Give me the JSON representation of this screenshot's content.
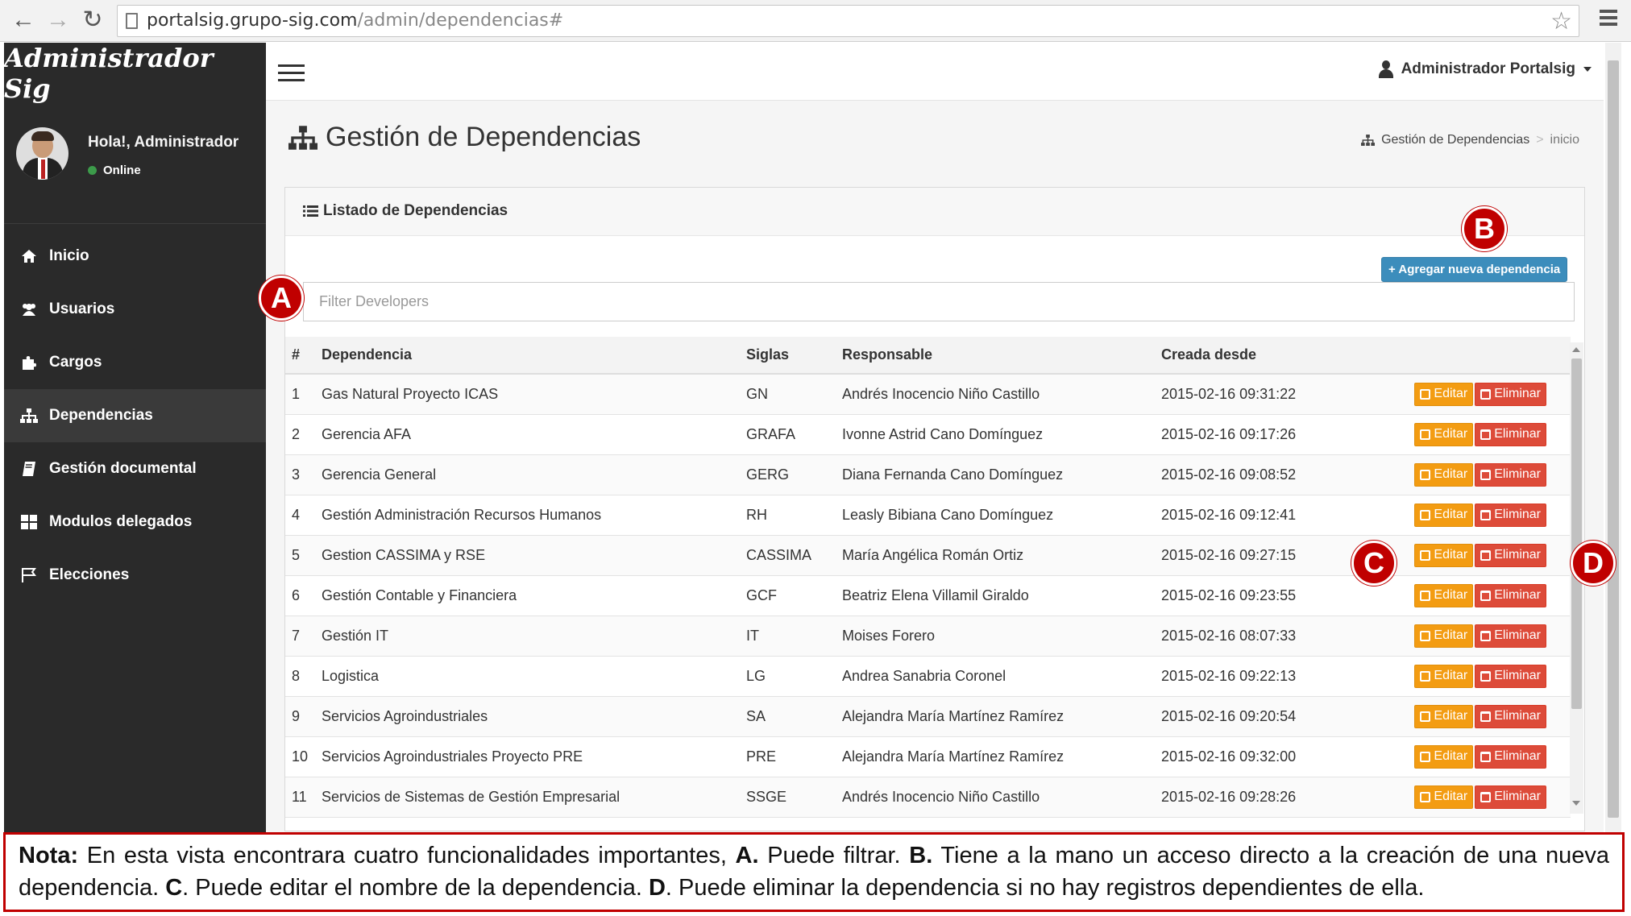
{
  "browser": {
    "url_host": "portalsig.grupo-sig.com",
    "url_path": "/admin/dependencias#"
  },
  "sidebar": {
    "brand": "Administrador Sig",
    "greeting": "Hola!, Administrador",
    "status": "Online",
    "items": [
      {
        "label": "Inicio",
        "icon": "home-icon"
      },
      {
        "label": "Usuarios",
        "icon": "users-icon"
      },
      {
        "label": "Cargos",
        "icon": "puzzle-icon"
      },
      {
        "label": "Dependencias",
        "icon": "sitemap-icon",
        "active": true
      },
      {
        "label": "Gestión documental",
        "icon": "book-icon"
      },
      {
        "label": "Modulos delegados",
        "icon": "grid-icon"
      },
      {
        "label": "Elecciones",
        "icon": "flag-icon"
      }
    ]
  },
  "topbar": {
    "user_label": "Administrador Portalsig"
  },
  "page": {
    "title": "Gestión de Dependencias",
    "breadcrumb": [
      "Gestión de Dependencias",
      "inicio"
    ]
  },
  "box": {
    "title": "Listado de Dependencias",
    "add_label": "+ Agregar nueva dependencia",
    "filter_placeholder": "Filter Developers"
  },
  "table": {
    "columns": [
      "#",
      "Dependencia",
      "Siglas",
      "Responsable",
      "Creada desde"
    ],
    "edit_label": "Editar",
    "delete_label": "Eliminar",
    "rows": [
      [
        "1",
        "Gas Natural Proyecto ICAS",
        "GN",
        "Andrés Inocencio Niño Castillo",
        "2015-02-16 09:31:22"
      ],
      [
        "2",
        "Gerencia AFA",
        "GRAFA",
        "Ivonne Astrid Cano Domínguez",
        "2015-02-16 09:17:26"
      ],
      [
        "3",
        "Gerencia General",
        "GERG",
        "Diana Fernanda Cano Domínguez",
        "2015-02-16 09:08:52"
      ],
      [
        "4",
        "Gestión Administración Recursos Humanos",
        "RH",
        "Leasly Bibiana Cano Domínguez",
        "2015-02-16 09:12:41"
      ],
      [
        "5",
        "Gestion CASSIMA y RSE",
        "CASSIMA",
        "María Angélica Román Ortiz",
        "2015-02-16 09:27:15"
      ],
      [
        "6",
        "Gestión Contable y Financiera",
        "GCF",
        "Beatriz Elena Villamil Giraldo",
        "2015-02-16 09:23:55"
      ],
      [
        "7",
        "Gestión IT",
        "IT",
        "Moises Forero",
        "2015-02-16 08:07:33"
      ],
      [
        "8",
        "Logistica",
        "LG",
        "Andrea Sanabria Coronel",
        "2015-02-16 09:22:13"
      ],
      [
        "9",
        "Servicios Agroindustriales",
        "SA",
        "Alejandra María Martínez Ramírez",
        "2015-02-16 09:20:54"
      ],
      [
        "10",
        "Servicios Agroindustriales Proyecto PRE",
        "PRE",
        "Alejandra María Martínez Ramírez",
        "2015-02-16 09:32:00"
      ],
      [
        "11",
        "Servicios de Sistemas de Gestión Empresarial",
        "SSGE",
        "Andrés Inocencio Niño Castillo",
        "2015-02-16 09:28:26"
      ]
    ]
  },
  "markers": [
    "A",
    "B",
    "C",
    "D"
  ],
  "note": {
    "prefix": "Nota:",
    "s1": " En esta vista encontrara cuatro funcionalidades importantes, ",
    "a": "A.",
    "s2": " Puede filtrar. ",
    "b": "B.",
    "s3": " Tiene a la mano un acceso directo a la creación de una nueva dependencia. ",
    "c": "C",
    "s4": ". Puede editar el nombre de la dependencia. ",
    "d": "D",
    "s5": ". Puede eliminar la dependencia si no hay registros dependientes de ella."
  },
  "colors": {
    "sidebar_bg": "#2a2a2a",
    "primary": "#3c8dbc",
    "warning": "#f39c12",
    "danger": "#dd4b39",
    "marker": "#c00000"
  }
}
